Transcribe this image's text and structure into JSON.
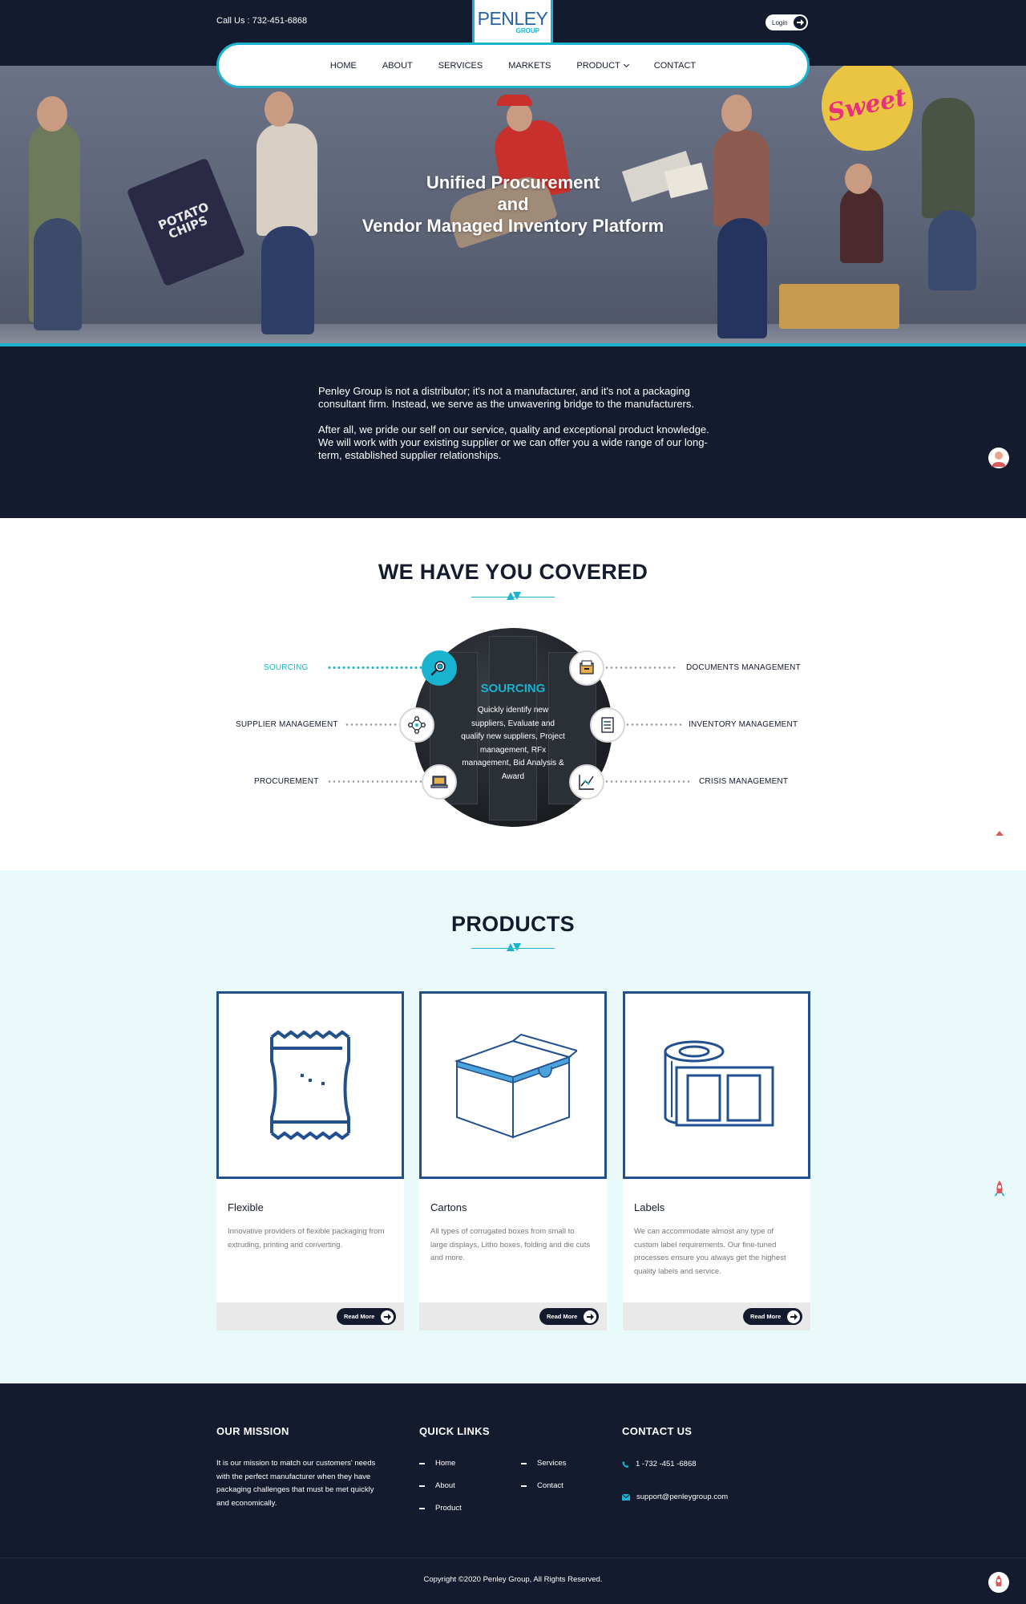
{
  "header": {
    "call": "Call Us : 732-451-6868",
    "logo_text": "PENLEY",
    "logo_sub": "GROUP",
    "login_label": "Login"
  },
  "nav": {
    "items": [
      {
        "label": "HOME"
      },
      {
        "label": "ABOUT"
      },
      {
        "label": "SERVICES"
      },
      {
        "label": "MARKETS"
      },
      {
        "label": "PRODUCT",
        "has_dropdown": true
      },
      {
        "label": "CONTACT"
      }
    ]
  },
  "hero": {
    "title_line1": "Unified Procurement",
    "title_line2": "and",
    "title_line3": "Vendor Managed Inventory Platform",
    "chips_text": "POTATO CHIPS",
    "sign_text": "Sweet"
  },
  "intro": {
    "p1": "Penley Group is not a distributor; it's not a manufacturer, and it's not a packaging consultant firm. Instead, we serve as the unwavering bridge to the manufacturers.",
    "p2": "After all, we pride our self on our service, quality and exceptional product knowledge. We will work with your existing supplier or we can offer you a wide range of our long-term, established supplier relationships."
  },
  "covered": {
    "title": "WE HAVE YOU COVERED",
    "active": {
      "title": "SOURCING",
      "description": "Quickly identify new suppliers, Evaluate and qualify new suppliers, Project management, RFx management, Bid Analysis & Award"
    },
    "left_services": [
      {
        "label": "SOURCING",
        "icon": "magnifier-icon",
        "active": true
      },
      {
        "label": "SUPPLIER MANAGEMENT",
        "icon": "network-icon",
        "active": false
      },
      {
        "label": "PROCUREMENT",
        "icon": "laptop-icon",
        "active": false
      }
    ],
    "right_services": [
      {
        "label": "DOCUMENTS MANAGEMENT",
        "icon": "file-drawer-icon"
      },
      {
        "label": "INVENTORY MANAGEMENT",
        "icon": "checklist-icon"
      },
      {
        "label": "CRISIS MANAGEMENT",
        "icon": "line-chart-icon"
      }
    ],
    "accent": "#19b3cf"
  },
  "products": {
    "title": "PRODUCTS",
    "cards": [
      {
        "title": "Flexible",
        "description": "Innovative providers of flexible packaging from extruding, printing and converting.",
        "button": "Read More",
        "icon": "flexible-pouch-icon"
      },
      {
        "title": "Cartons",
        "description": "All types of corrugated boxes from small to large displays, Litho boxes, folding and die cuts and more.",
        "button": "Read More",
        "icon": "carton-box-icon"
      },
      {
        "title": "Labels",
        "description": "We can accommodate almost any type of custom label requirements. Our fine-tuned processes ensure you always get the highest quality labels and service.",
        "button": "Read More",
        "icon": "label-roll-icon"
      }
    ]
  },
  "footer": {
    "mission_title": "OUR MISSION",
    "mission_text": "It is our mission to match our customers' needs with the perfect manufacturer when they have packaging challenges that must be met quickly and economically.",
    "links_title": "QUICK LINKS",
    "links": [
      "Home",
      "About",
      "Product",
      "Services",
      "Contact"
    ],
    "contact_title": "CONTACT US",
    "phone": "1 -732 -451 -6868",
    "email": "support@penleygroup.com",
    "copyright": "Copyright ©2020 Penley Group, All Rights Reserved."
  },
  "colors": {
    "navy": "#141b2e",
    "accent": "#19b3cf",
    "product_border": "#22508e",
    "products_bg": "#eafafa"
  }
}
